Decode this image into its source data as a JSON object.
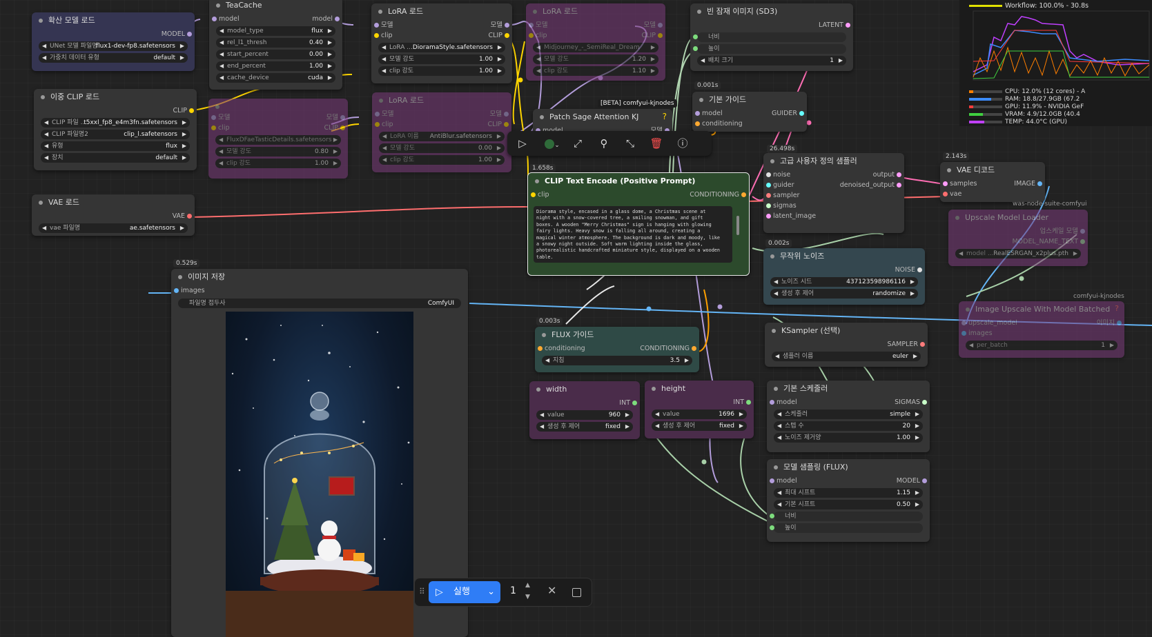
{
  "nodes": {
    "unet": {
      "title": "확산 모델 로드",
      "out": "MODEL",
      "w1_label": "UNet 모델 파일명",
      "w1_value": "flux1-dev-fp8.safetensors",
      "w2_label": "가중치 데이터 유형",
      "w2_value": "default"
    },
    "teacache": {
      "title": "TeaCache",
      "in": "model",
      "out": "model",
      "w": [
        {
          "label": "model_type",
          "value": "flux"
        },
        {
          "label": "rel_l1_thresh",
          "value": "0.40"
        },
        {
          "label": "start_percent",
          "value": "0.00"
        },
        {
          "label": "end_percent",
          "value": "1.00"
        },
        {
          "label": "cache_device",
          "value": "cuda"
        }
      ]
    },
    "lora1": {
      "title": "LoRA 로드",
      "in1": "모델",
      "in2": "clip",
      "out1": "모델",
      "out2": "CLIP",
      "w": [
        {
          "label": "LoRA ...",
          "value": "DioramaStyle.safetensors"
        },
        {
          "label": "모델 강도",
          "value": "1.00"
        },
        {
          "label": "clip 강도",
          "value": "1.00"
        }
      ]
    },
    "lora2": {
      "title": "LoRA 로드",
      "in1": "모델",
      "in2": "clip",
      "out1": "모델",
      "out2": "CLIP",
      "w": [
        {
          "label": "Midjourney_-_SemiReal_Dream",
          "value": ""
        },
        {
          "label": "모델 강도",
          "value": "1.20"
        },
        {
          "label": "clip 강도",
          "value": "1.10"
        }
      ]
    },
    "lora3": {
      "title": "LoRA 로드",
      "in1": "모델",
      "in2": "clip",
      "out1": "모델",
      "out2": "CLIP",
      "w": [
        {
          "label": "LoRA 이름",
          "value": "AntiBlur.safetensors"
        },
        {
          "label": "모델 강도",
          "value": "0.00"
        },
        {
          "label": "clip 강도",
          "value": "1.00"
        }
      ]
    },
    "lora4": {
      "in1": "모델",
      "in2": "clip",
      "out1": "모델",
      "out2": "CLIP",
      "w": [
        {
          "label": "FluxDFaeTasticDetails.safetensors",
          "value": ""
        },
        {
          "label": "모델 강도",
          "value": "0.80"
        },
        {
          "label": "clip 강도",
          "value": "1.00"
        }
      ]
    },
    "latent": {
      "title": "빈 잠재 이미지 (SD3)",
      "out": "LATENT",
      "w": [
        {
          "label": "너비",
          "value": ""
        },
        {
          "label": "높이",
          "value": ""
        },
        {
          "label": "배치 크기",
          "value": "1"
        }
      ]
    },
    "dualclip": {
      "title": "이중 CLIP 로드",
      "out": "CLIP",
      "w": [
        {
          "label": "CLIP 파일 ...",
          "value": "t5xxl_fp8_e4m3fn.safetensors"
        },
        {
          "label": "CLIP 파일명2",
          "value": "clip_l.safetensors"
        },
        {
          "label": "유형",
          "value": "flux"
        },
        {
          "label": "장치",
          "value": "default"
        }
      ]
    },
    "guider": {
      "badge": "0.001s",
      "title": "기본 가이드",
      "in1": "model",
      "in2": "conditioning",
      "out": "GUIDER"
    },
    "patchsage": {
      "title": "Patch Sage Attention KJ",
      "in": "model",
      "out": "모델",
      "tag": "[BETA] comfyui-kjnodes",
      "help": "?"
    },
    "sampler_adv": {
      "badge": "26.498s",
      "title": "고급 사용자 정의 샘플러",
      "in": [
        "noise",
        "guider",
        "sampler",
        "sigmas",
        "latent_image"
      ],
      "out1": "output",
      "out2": "denoised_output"
    },
    "vaedecode": {
      "badge": "2.143s",
      "title": "VAE 디코드",
      "in1": "samples",
      "in2": "vae",
      "out": "IMAGE"
    },
    "vaeload": {
      "title": "VAE 로드",
      "out": "VAE",
      "w_label": "vae 파일명",
      "w_value": "ae.safetensors"
    },
    "clipenc": {
      "badge": "1.658s",
      "title": "CLIP Text Encode (Positive Prompt)",
      "in": "clip",
      "out": "CONDITIONING",
      "text": "Diorama style, encased in a glass dome, a Christmas scene at night with a snow-covered tree, a smiling snowman, and gift boxes. A wooden \"Merry Christmas\" sign is hanging with glowing fairy lights. Heavy snow is falling all around, creating a magical winter atmosphere. The background is dark and moody, like a snowy night outside. Soft warm lighting inside the glass, photorealistic handcrafted miniature style, displayed on a wooden table."
    },
    "upscale_loader": {
      "tag": "was-node-suite-comfyui",
      "title": "Upscale Model Loader",
      "out1": "업스케일 모델",
      "out2": "MODEL_NAME_TEXT",
      "w_label": "model ...",
      "w_value": "RealESRGAN_x2plus.pth"
    },
    "noise": {
      "badge": "0.002s",
      "title": "무작위 노이즈",
      "out": "NOISE",
      "w1_label": "노이즈 시드",
      "w1_value": "437123598986116",
      "w2_label": "생성 후 제어",
      "w2_value": "randomize"
    },
    "upscale_batch": {
      "tag": "comfyui-kjnodes",
      "title": "Image Upscale With Model Batched",
      "help": "?",
      "in1": "upscale_model",
      "in2": "images",
      "out": "이미지",
      "w_label": "per_batch",
      "w_value": "1"
    },
    "saveimg": {
      "badge": "0.529s",
      "title": "이미지 저장",
      "in": "images",
      "w_label": "파일명 접두사",
      "w_value": "ComfyUI"
    },
    "flux_guide": {
      "badge": "0.003s",
      "title": "FLUX 가이드",
      "in": "conditioning",
      "out": "CONDITIONING",
      "w_label": "지침",
      "w_value": "3.5"
    },
    "ksampler": {
      "title": "KSampler (선택)",
      "out": "SAMPLER",
      "w_label": "샘플러 이름",
      "w_value": "euler"
    },
    "width": {
      "title": "width",
      "out": "INT",
      "w1_label": "value",
      "w1_value": "960",
      "w2_label": "생성 후 제어",
      "w2_value": "fixed"
    },
    "height": {
      "title": "height",
      "out": "INT",
      "w1_label": "value",
      "w1_value": "1696",
      "w2_label": "생성 후 제어",
      "w2_value": "fixed"
    },
    "scheduler": {
      "title": "기본 스케줄러",
      "in": "model",
      "out": "SIGMAS",
      "w": [
        {
          "label": "스케줄러",
          "value": "simple"
        },
        {
          "label": "스텝 수",
          "value": "20"
        },
        {
          "label": "노이즈 제거양",
          "value": "1.00"
        }
      ]
    },
    "modelsampling": {
      "title": "모델 샘플링 (FLUX)",
      "in": "model",
      "out": "MODEL",
      "w": [
        {
          "label": "최대 시프트",
          "value": "1.15"
        },
        {
          "label": "기본 시프트",
          "value": "0.50"
        },
        {
          "label": "너비",
          "value": ""
        },
        {
          "label": "높이",
          "value": ""
        }
      ]
    }
  },
  "monitor": {
    "workflow": "Workflow: 100.0% - 30.8s",
    "cpu": "CPU: 12.0% (12 cores) - A",
    "ram": "RAM: 18.8/27.9GB (67.2",
    "gpu": "GPU: 11.9% - NVIDIA GeF",
    "vram": "VRAM: 4.9/12.0GB (40.4",
    "temp": "TEMP: 44.0°C (GPU)",
    "colors": {
      "workflow": "#e0e000",
      "cpu": "#ff7f00",
      "ram": "#3c8cff",
      "gpu": "#ff3c3c",
      "vram": "#40d040",
      "temp": "#c040ff"
    }
  },
  "bottom": {
    "run_label": "실행",
    "count": "1"
  }
}
